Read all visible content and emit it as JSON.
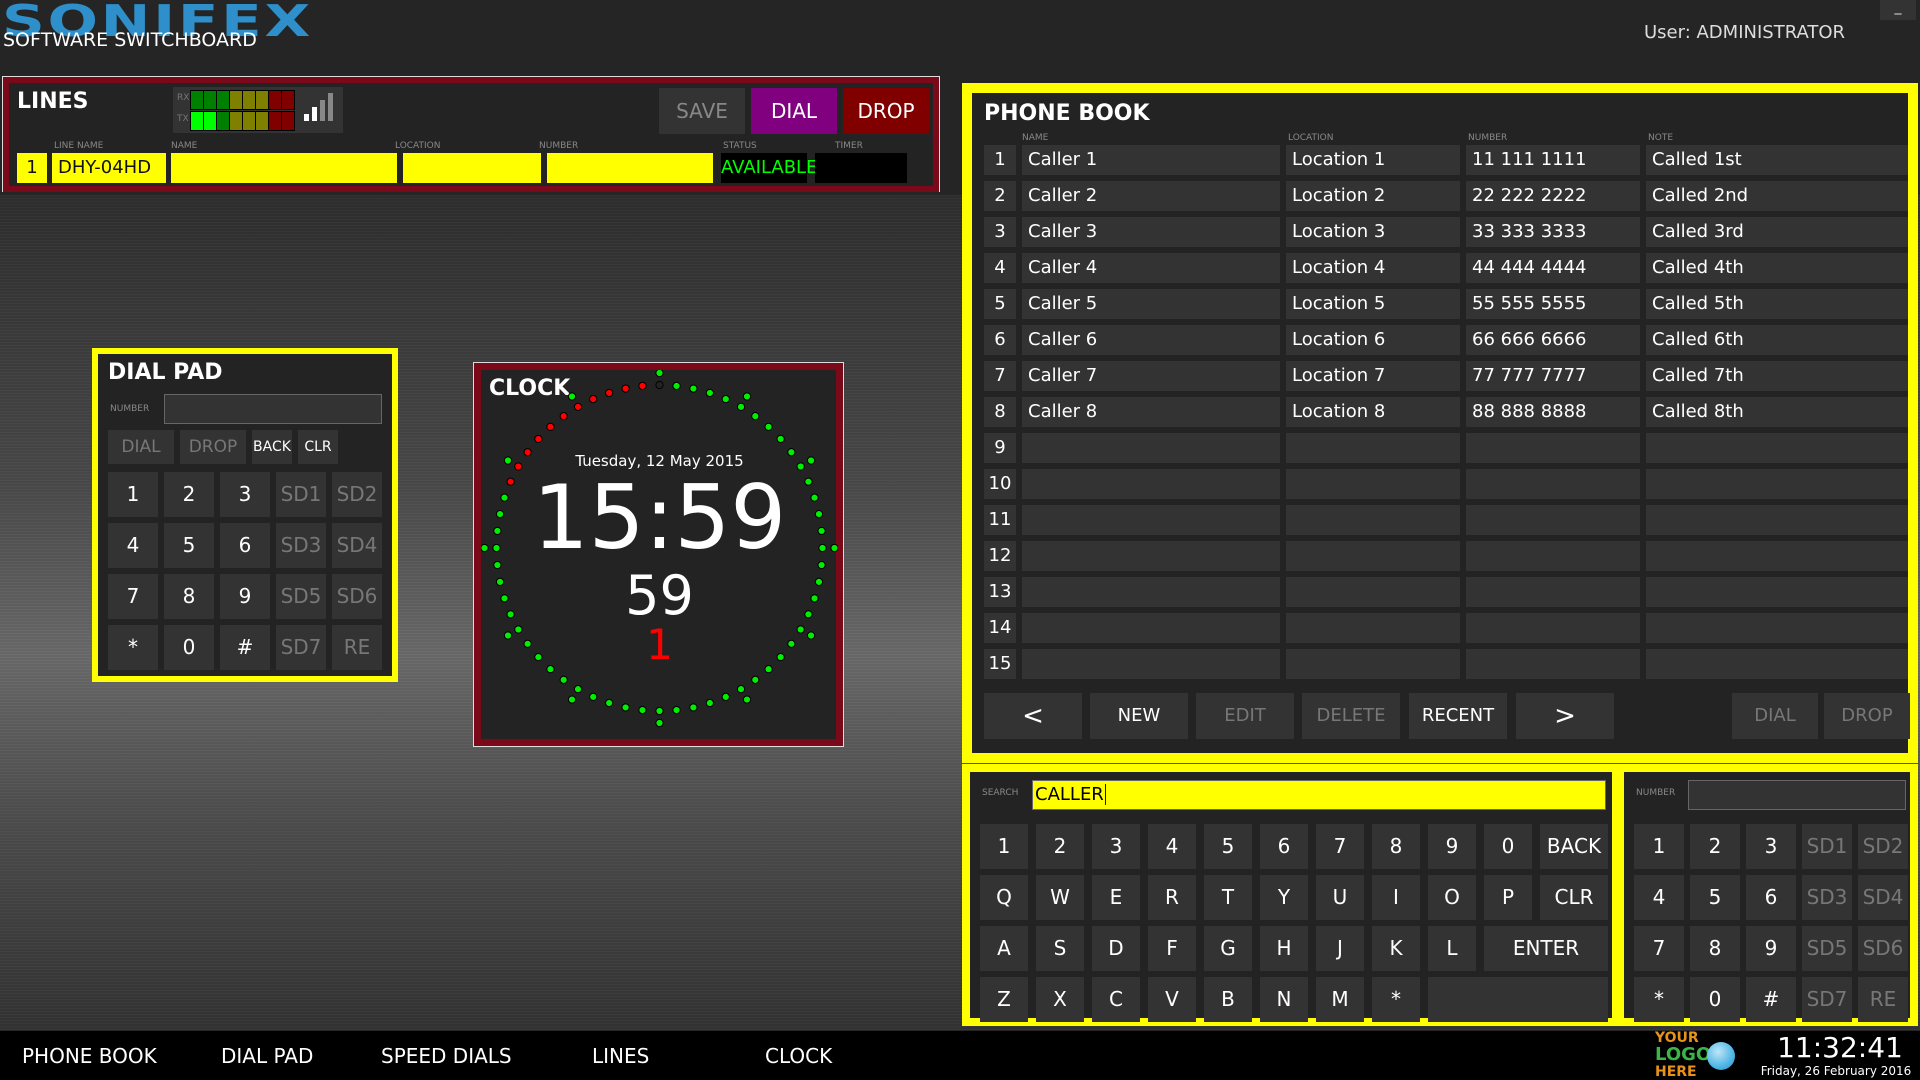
{
  "header": {
    "brand": "SONIFEX",
    "subtitle": "SOFTWARE SWITCHBOARD",
    "user": "User: ADMINISTRATOR",
    "minimize": "_"
  },
  "colors": {
    "accent_yellow": "#ffff00",
    "lines_border": "#7a0a1a",
    "dial_purple": "#800080",
    "drop_red": "#800000",
    "status_green": "#00ff00",
    "brand_blue": "#2e8fcb"
  },
  "lines": {
    "title": "LINES",
    "meter": {
      "rx_label": "RX",
      "tx_label": "TX",
      "rx_segments": [
        "#008000",
        "#008000",
        "#008000",
        "#808000",
        "#808000",
        "#808000",
        "#800000",
        "#800000"
      ],
      "tx_segments": [
        "#00ff00",
        "#00ff00",
        "#008000",
        "#808000",
        "#808000",
        "#808000",
        "#800000",
        "#800000"
      ],
      "signal_bars_active": 2,
      "signal_bars_total": 4
    },
    "buttons": {
      "save": "SAVE",
      "dial": "DIAL",
      "drop": "DROP"
    },
    "columns": {
      "line_name": "LINE NAME",
      "name": "NAME",
      "location": "LOCATION",
      "number": "NUMBER",
      "status": "STATUS",
      "timer": "TIMER"
    },
    "row": {
      "index": "1",
      "line_name": "DHY-04HD",
      "name": "",
      "location": "",
      "number": "",
      "status": "AVAILABLE",
      "timer": ""
    }
  },
  "dialpad": {
    "title": "DIAL PAD",
    "number_label": "NUMBER",
    "number_value": "",
    "top_buttons": [
      "DIAL",
      "DROP",
      "BACK",
      "CLR"
    ],
    "keys": [
      [
        "1",
        "2",
        "3",
        "SD1",
        "SD2"
      ],
      [
        "4",
        "5",
        "6",
        "SD3",
        "SD4"
      ],
      [
        "7",
        "8",
        "9",
        "SD5",
        "SD6"
      ],
      [
        "*",
        "0",
        "#",
        "SD7",
        "RE"
      ]
    ]
  },
  "clock": {
    "title": "CLOCK",
    "date": "Tuesday, 12 May 2015",
    "time": "15:59",
    "seconds": "59",
    "countdown": "1",
    "seconds_elapsed": 59,
    "red_seconds_from": 49
  },
  "phonebook": {
    "title": "PHONE BOOK",
    "columns": {
      "name": "NAME",
      "location": "LOCATION",
      "number": "NUMBER",
      "note": "NOTE"
    },
    "rows": [
      {
        "n": "1",
        "name": "Caller 1",
        "location": "Location 1",
        "number": "11 111 1111",
        "note": "Called 1st"
      },
      {
        "n": "2",
        "name": "Caller 2",
        "location": "Location 2",
        "number": "22 222 2222",
        "note": "Called 2nd"
      },
      {
        "n": "3",
        "name": "Caller 3",
        "location": "Location 3",
        "number": "33 333 3333",
        "note": "Called 3rd"
      },
      {
        "n": "4",
        "name": "Caller 4",
        "location": "Location 4",
        "number": "44 444 4444",
        "note": "Called 4th"
      },
      {
        "n": "5",
        "name": "Caller 5",
        "location": "Location 5",
        "number": "55 555 5555",
        "note": "Called 5th"
      },
      {
        "n": "6",
        "name": "Caller 6",
        "location": "Location 6",
        "number": "66 666 6666",
        "note": "Called 6th"
      },
      {
        "n": "7",
        "name": "Caller 7",
        "location": "Location 7",
        "number": "77 777 7777",
        "note": "Called 7th"
      },
      {
        "n": "8",
        "name": "Caller 8",
        "location": "Location 8",
        "number": "88 888 8888",
        "note": "Called 8th"
      },
      {
        "n": "9",
        "name": "",
        "location": "",
        "number": "",
        "note": ""
      },
      {
        "n": "10",
        "name": "",
        "location": "",
        "number": "",
        "note": ""
      },
      {
        "n": "11",
        "name": "",
        "location": "",
        "number": "",
        "note": ""
      },
      {
        "n": "12",
        "name": "",
        "location": "",
        "number": "",
        "note": ""
      },
      {
        "n": "13",
        "name": "",
        "location": "",
        "number": "",
        "note": ""
      },
      {
        "n": "14",
        "name": "",
        "location": "",
        "number": "",
        "note": ""
      },
      {
        "n": "15",
        "name": "",
        "location": "",
        "number": "",
        "note": ""
      }
    ],
    "buttons": {
      "prev": "<",
      "new": "NEW",
      "edit": "EDIT",
      "delete": "DELETE",
      "recent": "RECENT",
      "next": ">",
      "dial": "DIAL",
      "drop": "DROP"
    }
  },
  "search": {
    "label": "SEARCH",
    "value": "CALLER",
    "keys": [
      [
        "1",
        "2",
        "3",
        "4",
        "5",
        "6",
        "7",
        "8",
        "9",
        "0",
        "BACK"
      ],
      [
        "Q",
        "W",
        "E",
        "R",
        "T",
        "Y",
        "U",
        "I",
        "O",
        "P",
        "CLR"
      ],
      [
        "A",
        "S",
        "D",
        "F",
        "G",
        "H",
        "J",
        "K",
        "L",
        "ENTER"
      ],
      [
        "Z",
        "X",
        "C",
        "V",
        "B",
        "N",
        "M",
        "*",
        ""
      ]
    ]
  },
  "numpad": {
    "number_label": "NUMBER",
    "number_value": "",
    "keys": [
      [
        "1",
        "2",
        "3",
        "SD1",
        "SD2"
      ],
      [
        "4",
        "5",
        "6",
        "SD3",
        "SD4"
      ],
      [
        "7",
        "8",
        "9",
        "SD5",
        "SD6"
      ],
      [
        "*",
        "0",
        "#",
        "SD7",
        "RE"
      ]
    ]
  },
  "nav": {
    "items": [
      "PHONE BOOK",
      "DIAL PAD",
      "SPEED DIALS",
      "LINES",
      "CLOCK"
    ]
  },
  "footer": {
    "logo_line1": "YOUR",
    "logo_line2": "LOGO",
    "logo_line3": "HERE",
    "time": "11:32:41",
    "date": "Friday, 26 February 2016"
  }
}
